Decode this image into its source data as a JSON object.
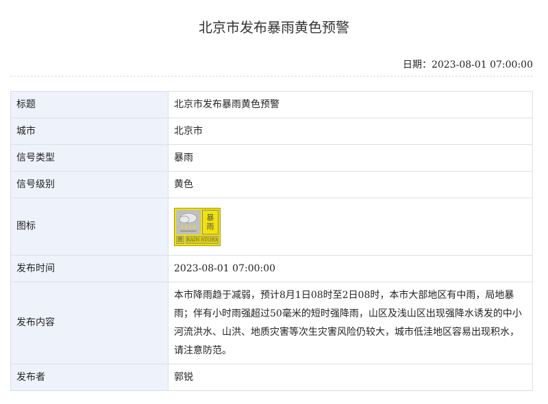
{
  "page": {
    "title": "北京市发布暴雨黄色预警",
    "date_label": "日期：",
    "date_value": "2023-08-01 07:00:00"
  },
  "rows": {
    "title": {
      "key": "标题",
      "value": "北京市发布暴雨黄色预警"
    },
    "city": {
      "key": "城市",
      "value": "北京市"
    },
    "signal_type": {
      "key": "信号类型",
      "value": "暴雨"
    },
    "signal_level": {
      "key": "信号级别",
      "value": "黄色"
    },
    "icon": {
      "key": "图标",
      "icon_name": "rainstorm-yellow-warning-icon",
      "icon_text_top": "暴",
      "icon_text_bottom": "雨",
      "icon_level_char": "黄",
      "icon_caption": "RAIN STORM",
      "color": "#f1e20a"
    },
    "publish_time": {
      "key": "发布时间",
      "value": "2023-08-01 07:00:00"
    },
    "content": {
      "key": "发布内容",
      "value": "本市降雨趋于减弱，预计8月1日08时至2日08时，本市大部地区有中雨，局地暴雨；伴有小时雨强超过50毫米的短时强降雨，山区及浅山区出现强降水诱发的中小河流洪水、山洪、地质灾害等次生灾害风险仍较大，城市低洼地区容易出现积水，请注意防范。"
    },
    "publisher": {
      "key": "发布者",
      "value": "郭锐"
    }
  },
  "colors": {
    "key_cell_bg": "#eef2fb",
    "border": "#d9dfe8",
    "warning_yellow": "#f1e20a"
  }
}
